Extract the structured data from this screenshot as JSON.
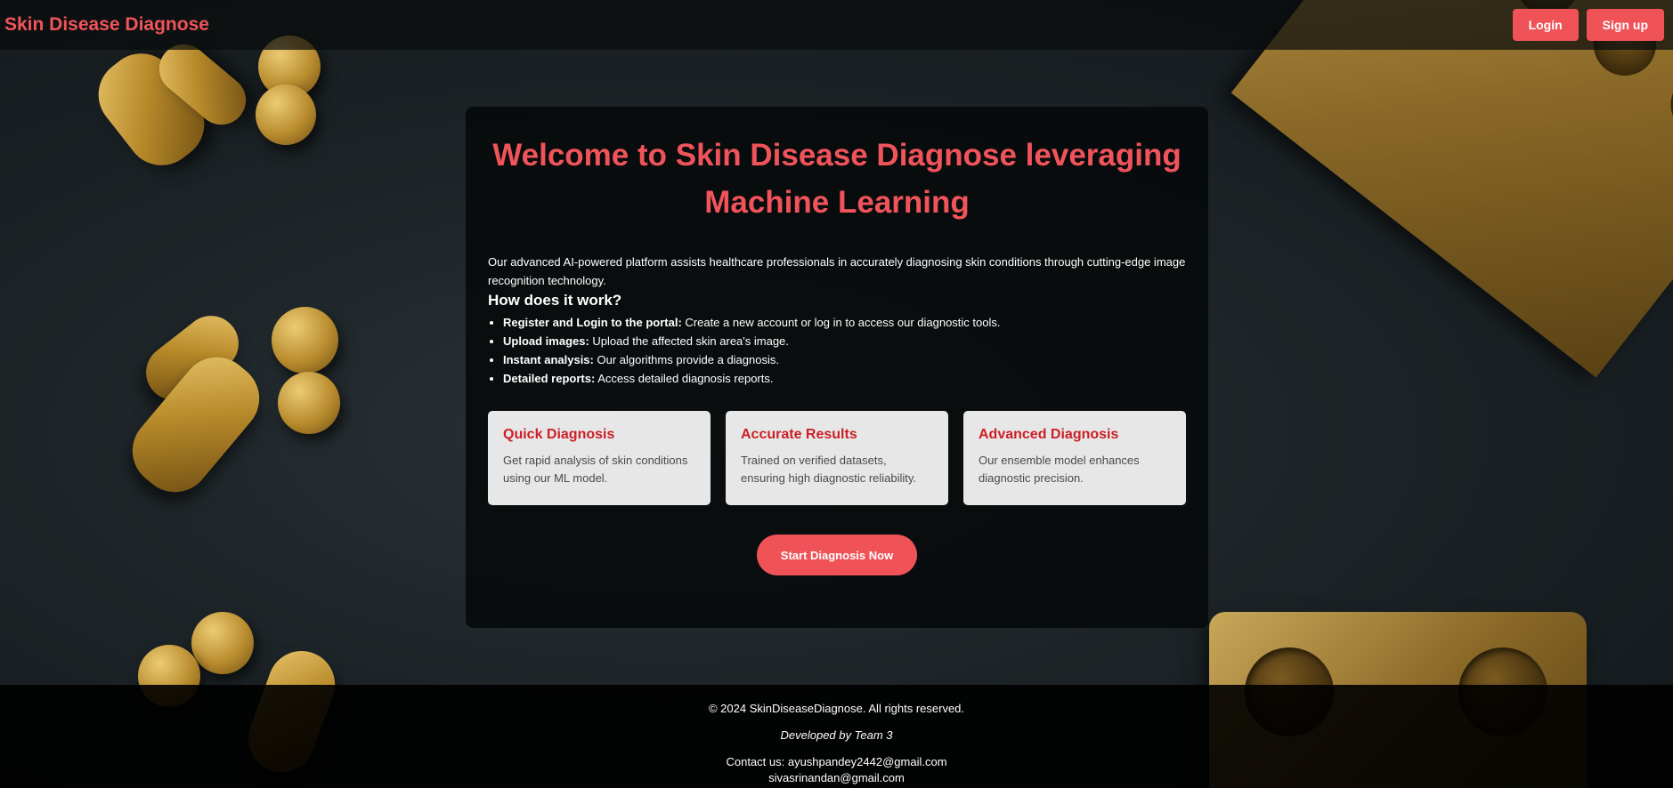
{
  "header": {
    "brand": "Skin Disease Diagnose",
    "login_label": "Login",
    "signup_label": "Sign up"
  },
  "hero": {
    "title": "Welcome to Skin Disease Diagnose leveraging Machine Learning",
    "intro": "Our advanced AI-powered platform assists healthcare professionals in accurately diagnosing skin conditions through cutting-edge image recognition technology.",
    "how_heading": "How does it work?",
    "steps": [
      {
        "title": "Register and Login to the portal:",
        "text": " Create a new account or log in to access our diagnostic tools."
      },
      {
        "title": "Upload images:",
        "text": " Upload the affected skin area's image."
      },
      {
        "title": "Instant analysis:",
        "text": " Our algorithms provide a diagnosis."
      },
      {
        "title": "Detailed reports:",
        "text": " Access detailed diagnosis reports."
      }
    ]
  },
  "features": [
    {
      "title": "Quick Diagnosis",
      "text": "Get rapid analysis of skin conditions using our ML model."
    },
    {
      "title": "Accurate Results",
      "text": "Trained on verified datasets, ensuring high diagnostic reliability."
    },
    {
      "title": "Advanced Diagnosis",
      "text": "Our ensemble model enhances diagnostic precision."
    }
  ],
  "cta_label": "Start Diagnosis Now",
  "footer": {
    "copyright": "© 2024 SkinDiseaseDiagnose. All rights reserved.",
    "developed_by": "Developed by Team 3",
    "contact": "Contact us: ayushpandey2442@gmail.com",
    "contact_2": "sivasrinandan@gmail.com"
  },
  "colors": {
    "accent": "#ef5358",
    "brand_text": "#f0545a",
    "feature_title": "#cc1f26",
    "feature_bg": "#e7e7e7"
  }
}
